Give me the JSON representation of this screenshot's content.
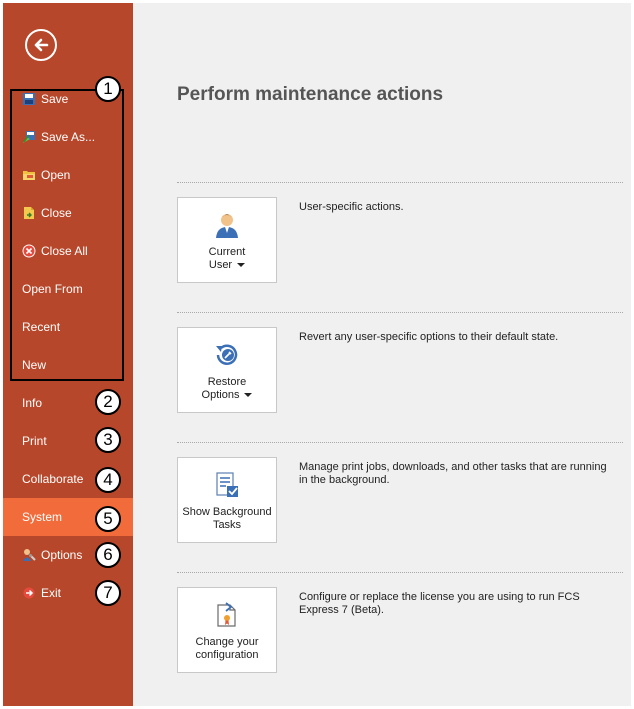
{
  "sidebar": {
    "back_label": "Back",
    "items": [
      {
        "label": "Save",
        "icon": "save-icon"
      },
      {
        "label": "Save As...",
        "icon": "save-as-icon"
      },
      {
        "label": "Open",
        "icon": "open-folder-icon"
      },
      {
        "label": "Close",
        "icon": "close-document-icon"
      },
      {
        "label": "Close All",
        "icon": "close-all-icon"
      },
      {
        "label": "Open From"
      },
      {
        "label": "Recent"
      },
      {
        "label": "New"
      },
      {
        "label": "Info"
      },
      {
        "label": "Print"
      },
      {
        "label": "Collaborate"
      },
      {
        "label": "System",
        "active": true
      },
      {
        "label": "Options",
        "icon": "options-icon"
      },
      {
        "label": "Exit",
        "icon": "exit-icon"
      }
    ]
  },
  "callouts": [
    "1",
    "2",
    "3",
    "4",
    "5",
    "6",
    "7"
  ],
  "main": {
    "title": "Perform maintenance actions",
    "actions": [
      {
        "label_line1": "Current",
        "label_line2": "User",
        "has_dropdown": true,
        "icon": "user-icon",
        "description": "User-specific actions."
      },
      {
        "label_line1": "Restore",
        "label_line2": "Options",
        "has_dropdown": true,
        "icon": "restore-icon",
        "description": "Revert any user-specific options to their default state."
      },
      {
        "label_line1": "Show Background",
        "label_line2": "Tasks",
        "has_dropdown": false,
        "icon": "tasks-icon",
        "description": "Manage print jobs, downloads, and other tasks that are running in the background."
      },
      {
        "label_line1": "Change your",
        "label_line2": "configuration",
        "has_dropdown": false,
        "icon": "configuration-icon",
        "description": "Configure or replace the license you are using to run FCS Express 7 (Beta)."
      }
    ]
  },
  "colors": {
    "sidebar_bg": "#b7472a",
    "active_item_bg": "#f26b3a",
    "content_bg": "#f0f0f0",
    "title_text": "#555555"
  }
}
